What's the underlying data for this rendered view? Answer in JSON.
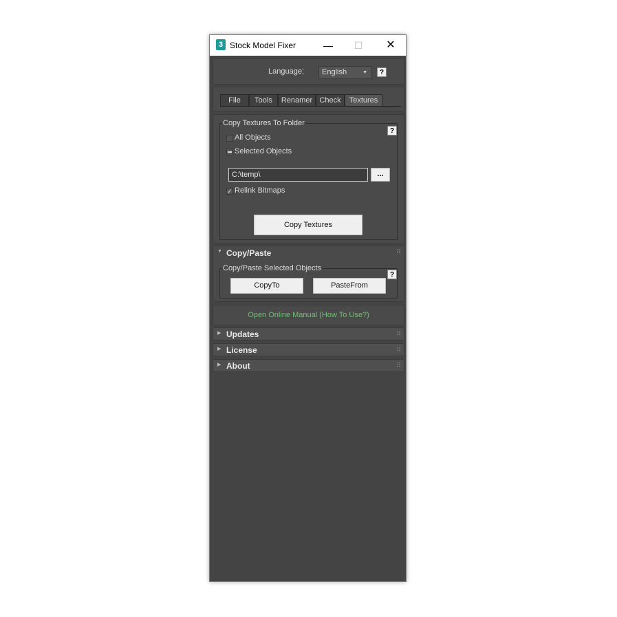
{
  "window": {
    "title": "Stock Model Fixer",
    "icon_label": "3",
    "controls": {
      "minimize": "—",
      "maximize": "☐",
      "close": "✕"
    }
  },
  "language": {
    "label": "Language:",
    "value": "English",
    "help": "?"
  },
  "tabs": [
    {
      "label": "File",
      "active": false
    },
    {
      "label": "Tools",
      "active": false
    },
    {
      "label": "Renamer",
      "active": false
    },
    {
      "label": "Check",
      "active": false
    },
    {
      "label": "Textures",
      "active": true
    }
  ],
  "copy_textures": {
    "group_title": "Copy Textures To Folder",
    "help": "?",
    "options": [
      {
        "label": "All Objects",
        "state": "unchecked"
      },
      {
        "label": "Selected Objects",
        "state": "indeterminate"
      }
    ],
    "path_value": "C:\\temp\\",
    "browse_label": "...",
    "relink_label": "Relink Bitmaps",
    "relink_checked": true,
    "copy_button": "Copy Textures"
  },
  "copy_paste": {
    "rollout_title": "Copy/Paste",
    "group_title": "Copy/Paste Selected Objects",
    "help": "?",
    "copy_to": "CopyTo",
    "paste_from": "PasteFrom"
  },
  "manual_link": "Open Online Manual (How To Use?)",
  "rollouts": [
    {
      "title": "Updates",
      "expanded": false
    },
    {
      "title": "License",
      "expanded": false
    },
    {
      "title": "About",
      "expanded": false
    }
  ],
  "colors": {
    "accent_link": "#6fbf73",
    "panel_bg": "#444444"
  }
}
